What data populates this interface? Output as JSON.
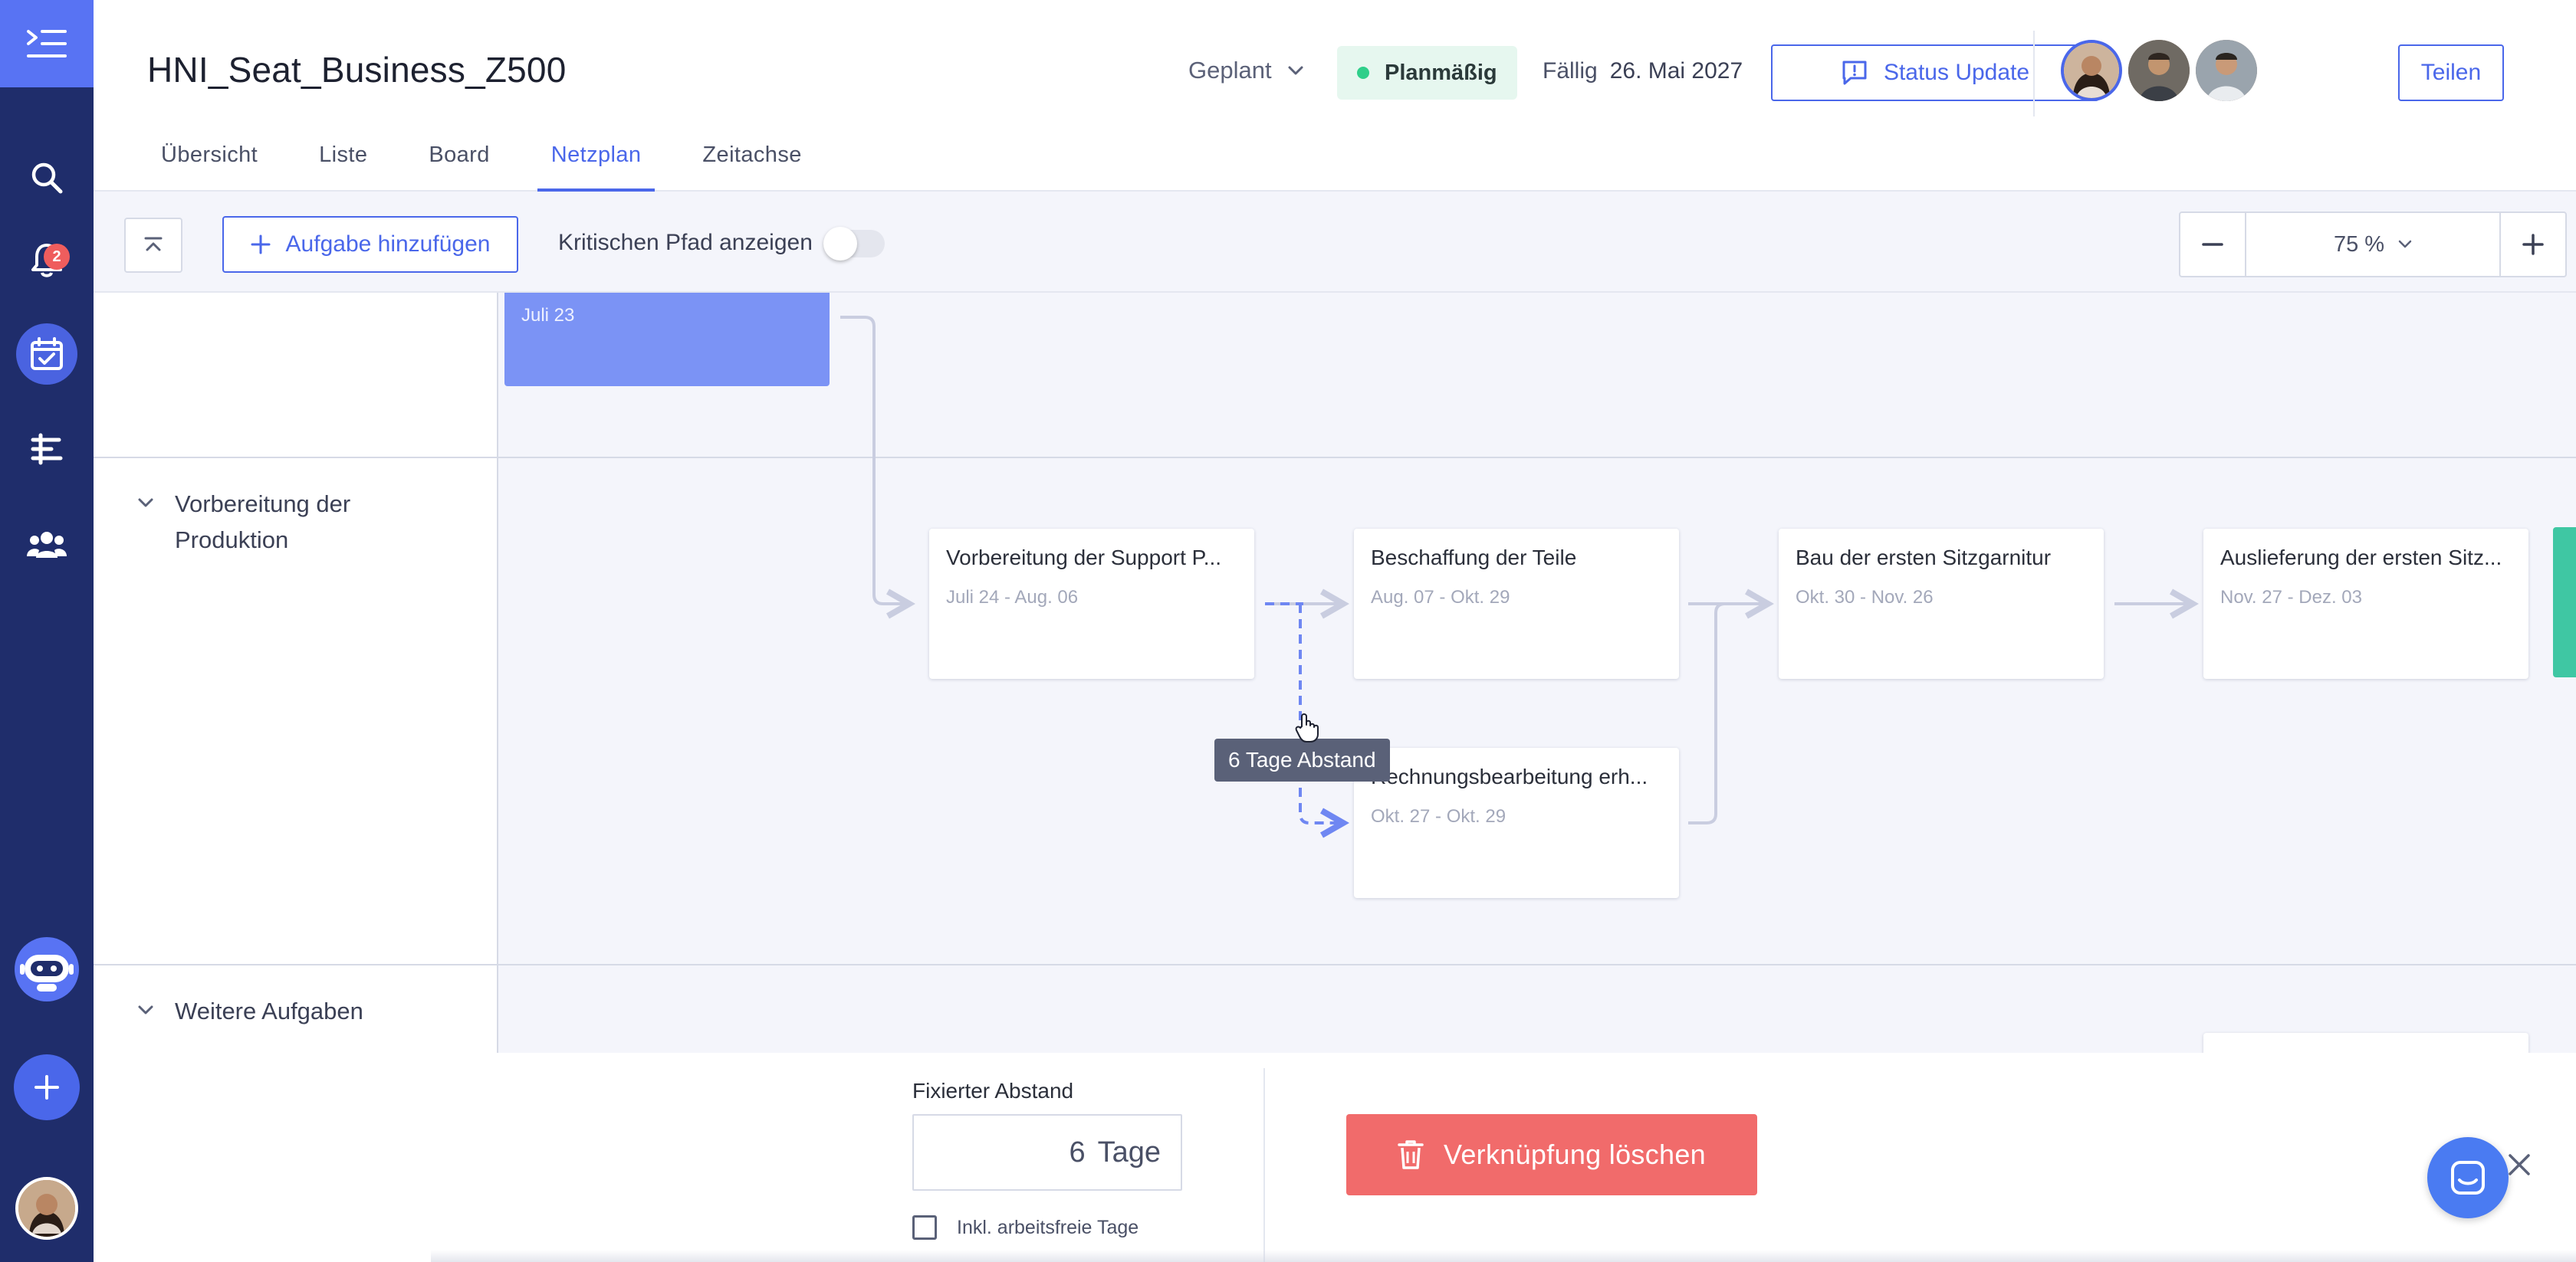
{
  "project": {
    "title": "HNI_Seat_Business_Z500",
    "status": "Geplant",
    "schedule_badge": "Planmäßig",
    "due_label": "Fällig",
    "due_date": "26. Mai 2027",
    "status_update_label": "Status Update",
    "share_label": "Teilen"
  },
  "tabs": [
    {
      "label": "Übersicht"
    },
    {
      "label": "Liste"
    },
    {
      "label": "Board"
    },
    {
      "label": "Netzplan"
    },
    {
      "label": "Zeitachse"
    }
  ],
  "active_tab": "Netzplan",
  "sidebar": {
    "notification_count": "2"
  },
  "toolbar": {
    "add_task_label": "Aufgabe hinzufügen",
    "critical_path_label": "Kritischen Pfad anzeigen",
    "critical_path_enabled": false,
    "zoom_value": "75 %"
  },
  "help_label": "?",
  "lanes": [
    {
      "title": "Vorbereitung der Produktion"
    },
    {
      "title": "Weitere Aufgaben"
    }
  ],
  "tasks": {
    "t0": {
      "name": "",
      "dates": "Juli 23"
    },
    "t1": {
      "name": "Vorbereitung der Support P...",
      "dates": "Juli 24 - Aug. 06"
    },
    "t2": {
      "name": "Beschaffung der Teile",
      "dates": "Aug. 07 - Okt. 29"
    },
    "t3": {
      "name": "Bau der ersten Sitzgarnitur",
      "dates": "Okt. 30 - Nov. 26"
    },
    "t4": {
      "name": "Auslieferung der ersten Sitz...",
      "dates": "Nov. 27 - Dez. 03"
    },
    "t5": {
      "name": "Rechnungsbearbeitung erh...",
      "dates": "Okt. 27 - Okt. 29"
    }
  },
  "tooltip": "6 Tage Abstand",
  "link_panel": {
    "fixed_label": "Fixierter Abstand",
    "fixed_value": "6",
    "fixed_unit": "Tage",
    "include_label": "Inkl. arbeitsfreie Tage",
    "include_checked": false,
    "delete_label": "Verknüpfung löschen"
  },
  "colors": {
    "sidebar": "#1f2d6b",
    "accent": "#4a67ea",
    "danger": "#f16b6b",
    "success": "#2fcf8a",
    "task_highlight": "#7b93f5"
  }
}
